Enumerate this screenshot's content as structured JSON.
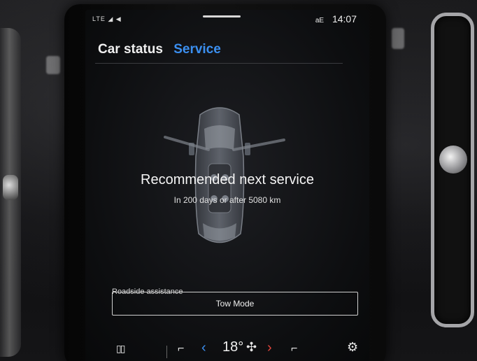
{
  "status_bar": {
    "left_indicators": "LTE ◢ ◀",
    "network_icon": "signal-icon",
    "time": "14:07",
    "bluetooth_label": "aE"
  },
  "tabs": [
    {
      "label": "Car status",
      "active": false
    },
    {
      "label": "Service",
      "active": true
    }
  ],
  "service": {
    "headline": "Recommended next service",
    "subline": "In 200 days or after 5080 km"
  },
  "roadside": {
    "label": "Roadside assistance",
    "tow_button": "Tow Mode"
  },
  "climate_bar": {
    "grid_icon": "app-grid-icon",
    "seat_left_icon": "seat-heat-left-icon",
    "temp_down_icon": "chevron-left-icon",
    "temperature": "18°",
    "fan_icon": "fan-icon",
    "temp_up_icon": "chevron-right-icon",
    "seat_right_icon": "seat-heat-right-icon",
    "settings_icon": "gear-icon",
    "grid_glyph": "▯▯",
    "seat_glyph": "⌐",
    "chev_left_glyph": "‹",
    "fan_glyph": "✣",
    "chev_right_glyph": "›",
    "gear_glyph": "⚙"
  },
  "colors": {
    "accent_blue": "#3b8ff0",
    "accent_red": "#e2453c",
    "screen_bg": "#0d0e10",
    "text": "#f2f2f2"
  }
}
